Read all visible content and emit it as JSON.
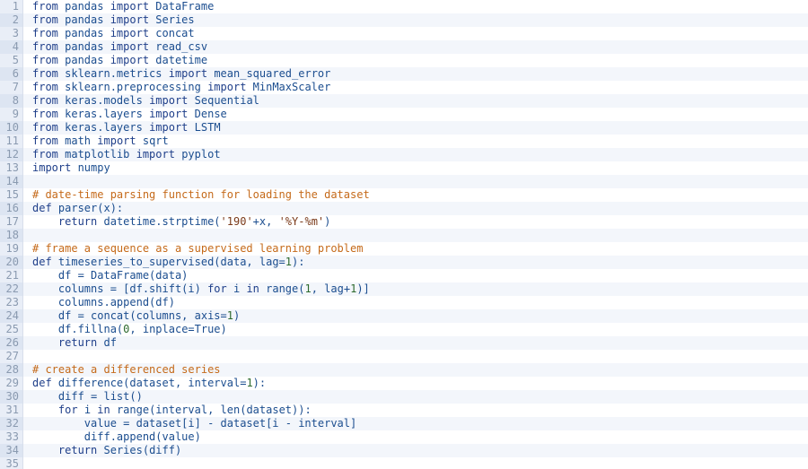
{
  "lines": [
    {
      "n": "1",
      "segs": [
        {
          "t": "from",
          "c": "kw"
        },
        {
          "t": " pandas ",
          "c": "sp"
        },
        {
          "t": "import",
          "c": "kw"
        },
        {
          "t": " DataFrame",
          "c": "sp"
        }
      ]
    },
    {
      "n": "2",
      "segs": [
        {
          "t": "from",
          "c": "kw"
        },
        {
          "t": " pandas ",
          "c": "sp"
        },
        {
          "t": "import",
          "c": "kw"
        },
        {
          "t": " Series",
          "c": "sp"
        }
      ]
    },
    {
      "n": "3",
      "segs": [
        {
          "t": "from",
          "c": "kw"
        },
        {
          "t": " pandas ",
          "c": "sp"
        },
        {
          "t": "import",
          "c": "kw"
        },
        {
          "t": " concat",
          "c": "sp"
        }
      ]
    },
    {
      "n": "4",
      "segs": [
        {
          "t": "from",
          "c": "kw"
        },
        {
          "t": " pandas ",
          "c": "sp"
        },
        {
          "t": "import",
          "c": "kw"
        },
        {
          "t": " read_csv",
          "c": "sp"
        }
      ]
    },
    {
      "n": "5",
      "segs": [
        {
          "t": "from",
          "c": "kw"
        },
        {
          "t": " pandas ",
          "c": "sp"
        },
        {
          "t": "import",
          "c": "kw"
        },
        {
          "t": " datetime",
          "c": "sp"
        }
      ]
    },
    {
      "n": "6",
      "segs": [
        {
          "t": "from",
          "c": "kw"
        },
        {
          "t": " sklearn.metrics ",
          "c": "sp"
        },
        {
          "t": "import",
          "c": "kw"
        },
        {
          "t": " mean_squared_error",
          "c": "sp"
        }
      ]
    },
    {
      "n": "7",
      "segs": [
        {
          "t": "from",
          "c": "kw"
        },
        {
          "t": " sklearn.preprocessing ",
          "c": "sp"
        },
        {
          "t": "import",
          "c": "kw"
        },
        {
          "t": " MinMaxScaler",
          "c": "sp"
        }
      ]
    },
    {
      "n": "8",
      "segs": [
        {
          "t": "from",
          "c": "kw"
        },
        {
          "t": " keras.models ",
          "c": "sp"
        },
        {
          "t": "import",
          "c": "kw"
        },
        {
          "t": " Sequential",
          "c": "sp"
        }
      ]
    },
    {
      "n": "9",
      "segs": [
        {
          "t": "from",
          "c": "kw"
        },
        {
          "t": " keras.layers ",
          "c": "sp"
        },
        {
          "t": "import",
          "c": "kw"
        },
        {
          "t": " Dense",
          "c": "sp"
        }
      ]
    },
    {
      "n": "10",
      "segs": [
        {
          "t": "from",
          "c": "kw"
        },
        {
          "t": " keras.layers ",
          "c": "sp"
        },
        {
          "t": "import",
          "c": "kw"
        },
        {
          "t": " LSTM",
          "c": "sp"
        }
      ]
    },
    {
      "n": "11",
      "segs": [
        {
          "t": "from",
          "c": "kw"
        },
        {
          "t": " math ",
          "c": "sp"
        },
        {
          "t": "import",
          "c": "kw"
        },
        {
          "t": " sqrt",
          "c": "sp"
        }
      ]
    },
    {
      "n": "12",
      "segs": [
        {
          "t": "from",
          "c": "kw"
        },
        {
          "t": " matplotlib ",
          "c": "sp"
        },
        {
          "t": "import",
          "c": "kw"
        },
        {
          "t": " pyplot",
          "c": "sp"
        }
      ]
    },
    {
      "n": "13",
      "segs": [
        {
          "t": "import",
          "c": "kw"
        },
        {
          "t": " numpy",
          "c": "sp"
        }
      ]
    },
    {
      "n": "14",
      "segs": []
    },
    {
      "n": "15",
      "segs": [
        {
          "t": "# date-time parsing function for loading the dataset",
          "c": "cm"
        }
      ]
    },
    {
      "n": "16",
      "segs": [
        {
          "t": "def",
          "c": "kw"
        },
        {
          "t": " parser(x):",
          "c": "sp"
        }
      ]
    },
    {
      "n": "17",
      "segs": [
        {
          "t": "    ",
          "c": "sp"
        },
        {
          "t": "return",
          "c": "kw"
        },
        {
          "t": " datetime.strptime(",
          "c": "sp"
        },
        {
          "t": "'190'",
          "c": "str"
        },
        {
          "t": "+x, ",
          "c": "sp"
        },
        {
          "t": "'%Y-%m'",
          "c": "str"
        },
        {
          "t": ")",
          "c": "sp"
        }
      ]
    },
    {
      "n": "18",
      "segs": []
    },
    {
      "n": "19",
      "segs": [
        {
          "t": "# frame a sequence as a supervised learning problem",
          "c": "cm"
        }
      ]
    },
    {
      "n": "20",
      "segs": [
        {
          "t": "def",
          "c": "kw"
        },
        {
          "t": " timeseries_to_supervised(data, lag=",
          "c": "sp"
        },
        {
          "t": "1",
          "c": "num"
        },
        {
          "t": "):",
          "c": "sp"
        }
      ]
    },
    {
      "n": "21",
      "segs": [
        {
          "t": "    df = DataFrame(data)",
          "c": "sp"
        }
      ]
    },
    {
      "n": "22",
      "segs": [
        {
          "t": "    columns = [df.shift(i) ",
          "c": "sp"
        },
        {
          "t": "for",
          "c": "kw"
        },
        {
          "t": " i ",
          "c": "sp"
        },
        {
          "t": "in",
          "c": "kw"
        },
        {
          "t": " range(",
          "c": "sp"
        },
        {
          "t": "1",
          "c": "num"
        },
        {
          "t": ", lag+",
          "c": "sp"
        },
        {
          "t": "1",
          "c": "num"
        },
        {
          "t": ")]",
          "c": "sp"
        }
      ]
    },
    {
      "n": "23",
      "segs": [
        {
          "t": "    columns.append(df)",
          "c": "sp"
        }
      ]
    },
    {
      "n": "24",
      "segs": [
        {
          "t": "    df = concat(columns, axis=",
          "c": "sp"
        },
        {
          "t": "1",
          "c": "num"
        },
        {
          "t": ")",
          "c": "sp"
        }
      ]
    },
    {
      "n": "25",
      "segs": [
        {
          "t": "    df.fillna(",
          "c": "sp"
        },
        {
          "t": "0",
          "c": "num"
        },
        {
          "t": ", inplace=True)",
          "c": "sp"
        }
      ]
    },
    {
      "n": "26",
      "segs": [
        {
          "t": "    ",
          "c": "sp"
        },
        {
          "t": "return",
          "c": "kw"
        },
        {
          "t": " df",
          "c": "sp"
        }
      ]
    },
    {
      "n": "27",
      "segs": []
    },
    {
      "n": "28",
      "segs": [
        {
          "t": "# create a differenced series",
          "c": "cm"
        }
      ]
    },
    {
      "n": "29",
      "segs": [
        {
          "t": "def",
          "c": "kw"
        },
        {
          "t": " difference(dataset, interval=",
          "c": "sp"
        },
        {
          "t": "1",
          "c": "num"
        },
        {
          "t": "):",
          "c": "sp"
        }
      ]
    },
    {
      "n": "30",
      "segs": [
        {
          "t": "    diff = list()",
          "c": "sp"
        }
      ]
    },
    {
      "n": "31",
      "segs": [
        {
          "t": "    ",
          "c": "sp"
        },
        {
          "t": "for",
          "c": "kw"
        },
        {
          "t": " i ",
          "c": "sp"
        },
        {
          "t": "in",
          "c": "kw"
        },
        {
          "t": " range(interval, len(dataset)):",
          "c": "sp"
        }
      ]
    },
    {
      "n": "32",
      "segs": [
        {
          "t": "        value = dataset[i] - dataset[i - interval]",
          "c": "sp"
        }
      ]
    },
    {
      "n": "33",
      "segs": [
        {
          "t": "        diff.append(value)",
          "c": "sp"
        }
      ]
    },
    {
      "n": "34",
      "segs": [
        {
          "t": "    ",
          "c": "sp"
        },
        {
          "t": "return",
          "c": "kw"
        },
        {
          "t": " Series(diff)",
          "c": "sp"
        }
      ]
    },
    {
      "n": "35",
      "segs": []
    }
  ]
}
